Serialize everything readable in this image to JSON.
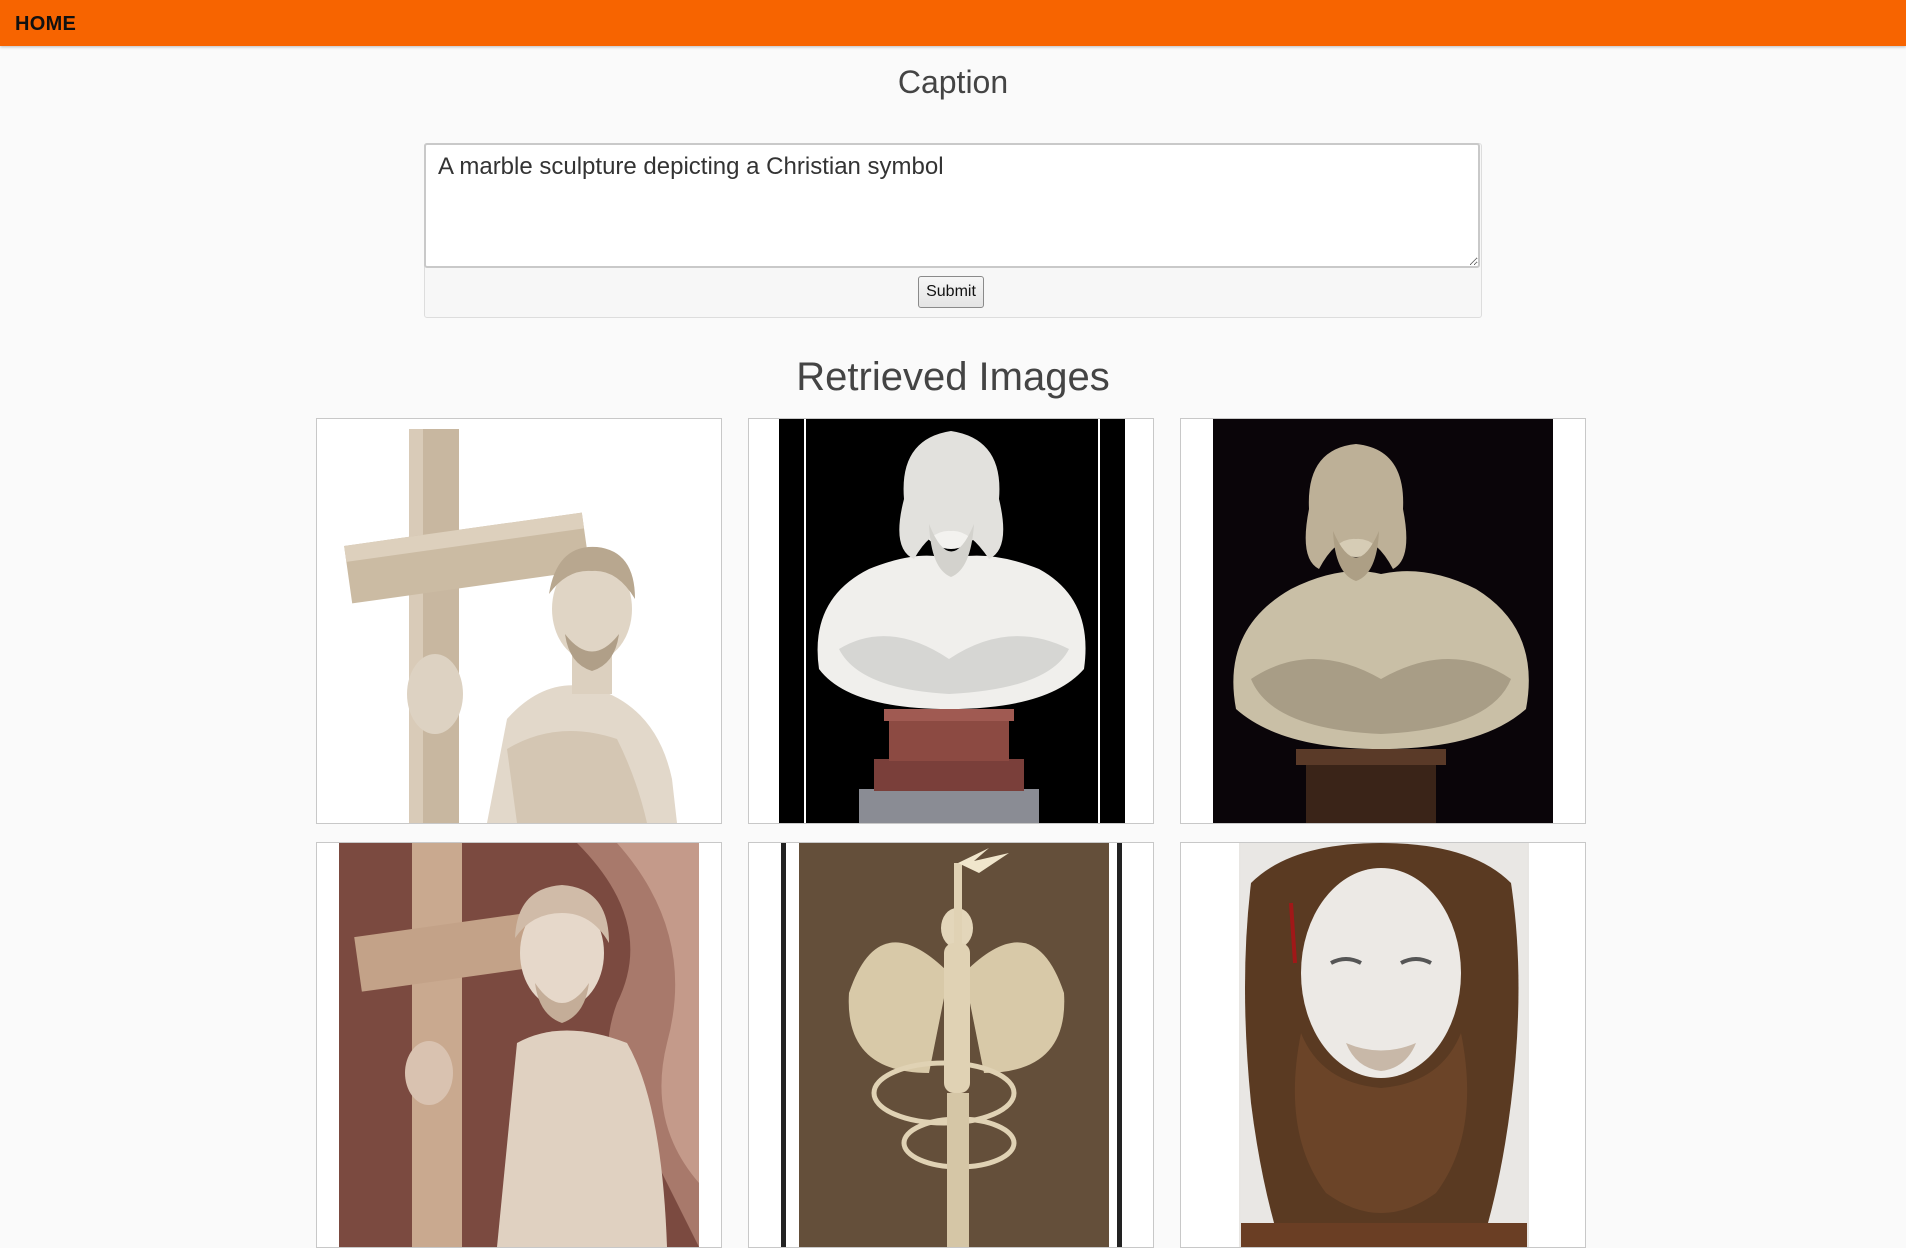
{
  "nav": {
    "home": "HOME"
  },
  "caption": {
    "title": "Caption",
    "input_value": "A marble sculpture depicting a Christian symbol",
    "submit_label": "Submit"
  },
  "results": {
    "title": "Retrieved Images",
    "images": [
      {
        "subject": "marble sculpture of Christ holding a cross"
      },
      {
        "subject": "marble bust of Christ on a marble pedestal"
      },
      {
        "subject": "marble bust of Christ on a dark background"
      },
      {
        "subject": "marble figure with a cross against veined marble"
      },
      {
        "subject": "winged bronze figure holding lightning bolts"
      },
      {
        "subject": "carved wooden head of Christ"
      }
    ]
  },
  "colors": {
    "nav_bg": "#f76400",
    "page_bg": "#fafafa",
    "text": "#444444"
  }
}
